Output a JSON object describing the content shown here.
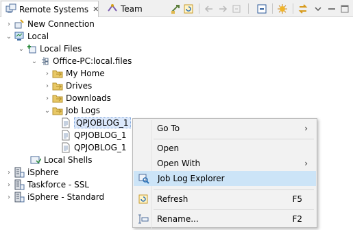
{
  "tabs": [
    {
      "label": "Remote Systems",
      "close": "✕"
    },
    {
      "label": "Team"
    }
  ],
  "toolbar_icons": [
    "link-editor-icon",
    "refresh-icon",
    "back-icon",
    "forward-icon",
    "home-icon",
    "collapse-all-icon",
    "sort-icon",
    "sync-icon",
    "view-menu-icon"
  ],
  "tree": [
    {
      "label": "New Connection",
      "icon": "new-connection-icon",
      "twisty": "›"
    },
    {
      "label": "Local",
      "icon": "local-system-icon",
      "twisty": "⌄"
    },
    {
      "label": "Local Files",
      "icon": "local-files-icon",
      "twisty": "⌄"
    },
    {
      "label": "Office-PC:local.files",
      "icon": "filter-icon",
      "twisty": "⌄"
    },
    {
      "label": "My Home",
      "icon": "folder-icon",
      "twisty": "›"
    },
    {
      "label": "Drives",
      "icon": "folder-icon",
      "twisty": "›"
    },
    {
      "label": "Downloads",
      "icon": "folder-icon",
      "twisty": "›"
    },
    {
      "label": "Job Logs",
      "icon": "folder-icon",
      "twisty": "⌄"
    },
    {
      "label": "QPJOBLOG_1",
      "icon": "file-icon",
      "twisty": ""
    },
    {
      "label": "QPJOBLOG_1",
      "icon": "file-icon",
      "twisty": ""
    },
    {
      "label": "QPJOBLOG_1",
      "icon": "file-icon",
      "twisty": ""
    },
    {
      "label": "Local Shells",
      "icon": "shells-icon",
      "twisty": ""
    },
    {
      "label": "iSphere",
      "icon": "system-icon",
      "twisty": "›"
    },
    {
      "label": "Taskforce - SSL",
      "icon": "system-icon",
      "twisty": "›"
    },
    {
      "label": "iSphere - Standard",
      "icon": "system-icon",
      "twisty": "›"
    }
  ],
  "menu": {
    "goto": {
      "label": "Go To",
      "arrow": "›"
    },
    "open": {
      "label": "Open"
    },
    "openwith": {
      "label": "Open With",
      "arrow": "›"
    },
    "joblog": {
      "label": "Job Log Explorer"
    },
    "refresh": {
      "label": "Refresh",
      "shortcut": "F5"
    },
    "rename": {
      "label": "Rename...",
      "shortcut": "F2"
    }
  },
  "colors": {
    "selection": "#dbe8fb",
    "menu_highlight": "#cce4f7",
    "folder": "#e8c866"
  }
}
